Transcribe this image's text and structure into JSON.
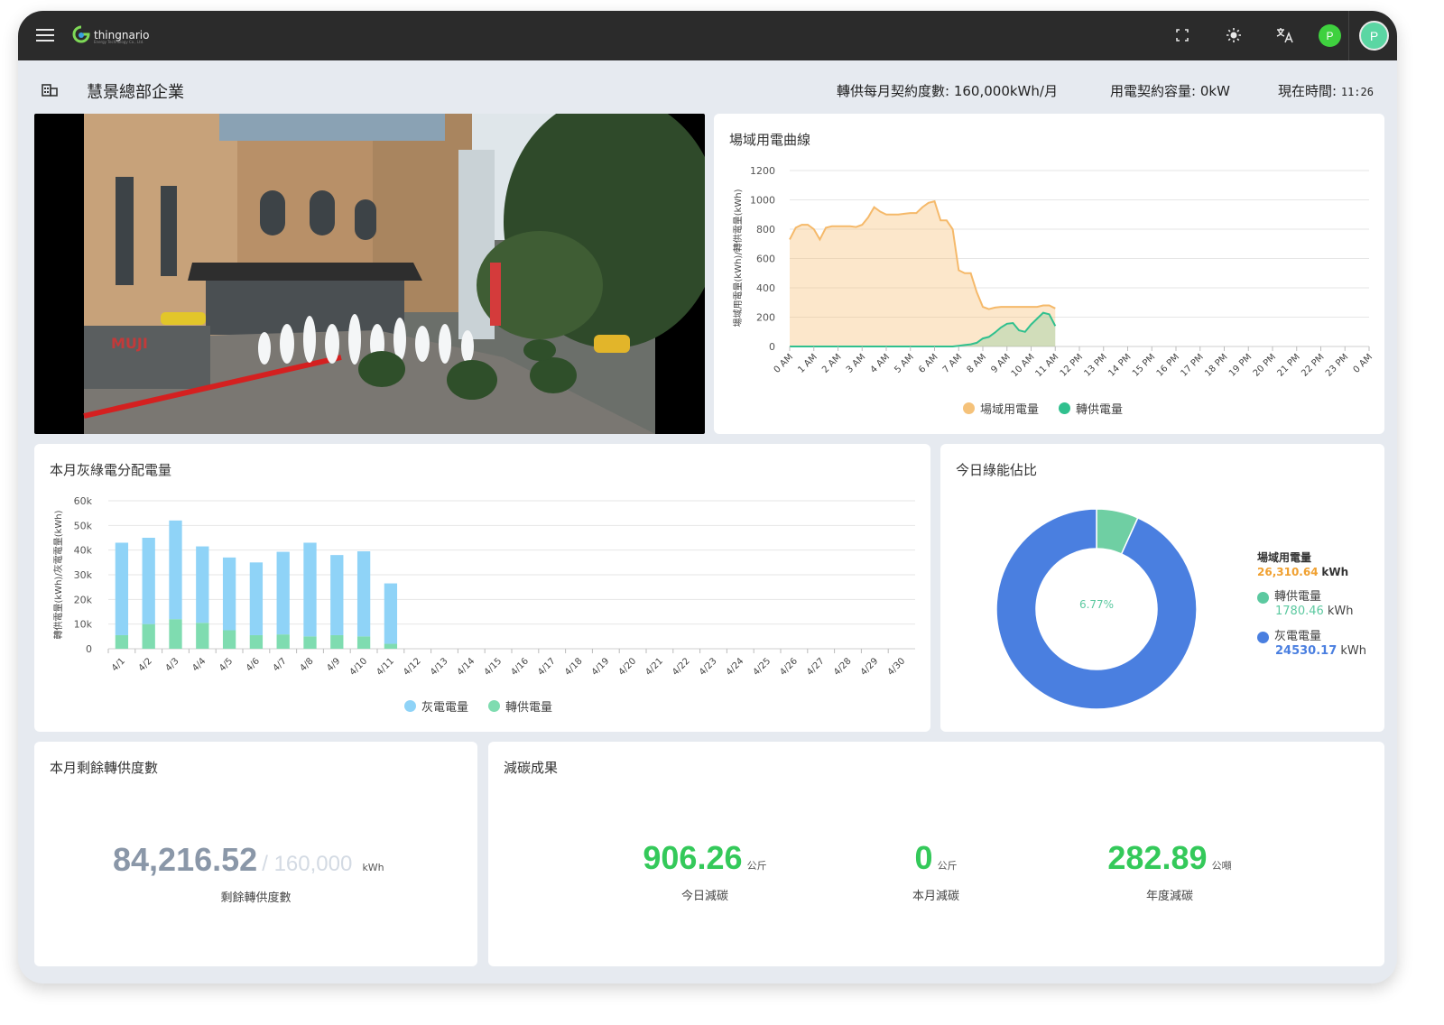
{
  "app": {
    "logo_text": "thingnario",
    "logo_subtext": "Energy Technology Co., Ltd.",
    "menu_icon": "hamburger-icon",
    "toolbar_icons": [
      "fullscreen-icon",
      "brightness-icon",
      "translate-icon"
    ],
    "status_avatar_letter": "P",
    "user_avatar_letter": "P",
    "status_avatar_color": "#3fd13f",
    "user_avatar_color": "#5bd6a3"
  },
  "header": {
    "company_name": "慧景總部企業",
    "contract_label": "轉供每月契約度數:",
    "contract_value": "160,000kWh/月",
    "capacity_label": "用電契約容量:",
    "capacity_value": "0kW",
    "time_label": "現在時間:",
    "time_value": "11:26"
  },
  "site_chart": {
    "title": "場域用電曲線",
    "chart_data": {
      "type": "area",
      "ylabel": "場域用電量(kWh)/轉供電量(kWh)",
      "ylim": [
        0,
        1200
      ],
      "yticks": [
        0,
        200,
        400,
        600,
        800,
        1000,
        1200
      ],
      "x_ticks": [
        "0 AM",
        "1 AM",
        "2 AM",
        "3 AM",
        "4 AM",
        "5 AM",
        "6 AM",
        "7 AM",
        "8 AM",
        "9 AM",
        "10 AM",
        "11 AM",
        "12 PM",
        "13 PM",
        "14 PM",
        "15 PM",
        "16 PM",
        "17 PM",
        "18 PM",
        "19 PM",
        "20 PM",
        "21 PM",
        "22 PM",
        "23 PM",
        "0 AM"
      ],
      "series": [
        {
          "name": "場域用電量",
          "color": "#f5b96a",
          "x": [
            0,
            0.25,
            0.5,
            0.75,
            1,
            1.25,
            1.5,
            1.75,
            2,
            2.25,
            2.5,
            2.75,
            3,
            3.25,
            3.5,
            3.75,
            4,
            4.25,
            4.5,
            4.75,
            5,
            5.25,
            5.5,
            5.75,
            6,
            6.25,
            6.5,
            6.75,
            7,
            7.25,
            7.5,
            7.75,
            8,
            8.25,
            8.5,
            8.75,
            9,
            9.25,
            9.5,
            9.75,
            10,
            10.25,
            10.5,
            10.75,
            11
          ],
          "y": [
            730,
            810,
            830,
            830,
            800,
            730,
            810,
            820,
            820,
            820,
            820,
            815,
            830,
            880,
            950,
            920,
            900,
            900,
            900,
            905,
            910,
            910,
            950,
            980,
            990,
            860,
            860,
            800,
            520,
            500,
            500,
            370,
            270,
            255,
            265,
            270,
            270,
            270,
            270,
            270,
            270,
            270,
            280,
            280,
            260
          ]
        },
        {
          "name": "轉供電量",
          "color": "#30c08e",
          "x": [
            0,
            0.25,
            0.5,
            0.75,
            1,
            1.25,
            1.5,
            1.75,
            2,
            2.25,
            2.5,
            2.75,
            3,
            3.25,
            3.5,
            3.75,
            4,
            4.25,
            4.5,
            4.75,
            5,
            5.25,
            5.5,
            5.75,
            6,
            6.25,
            6.5,
            6.75,
            7,
            7.25,
            7.5,
            7.75,
            8,
            8.25,
            8.5,
            8.75,
            9,
            9.25,
            9.5,
            9.75,
            10,
            10.25,
            10.5,
            10.75,
            11
          ],
          "y": [
            0,
            0,
            0,
            0,
            0,
            0,
            0,
            0,
            0,
            0,
            0,
            0,
            0,
            0,
            0,
            0,
            0,
            0,
            0,
            0,
            0,
            0,
            0,
            0,
            0,
            0,
            0,
            0,
            5,
            10,
            15,
            25,
            55,
            65,
            95,
            130,
            155,
            160,
            110,
            100,
            150,
            190,
            230,
            220,
            140
          ]
        }
      ]
    }
  },
  "monthly_chart": {
    "title": "本月灰綠電分配電量",
    "chart_data": {
      "type": "bar",
      "ylabel": "轉供電量(kWh)/灰電電量(kWh)",
      "ylim": [
        0,
        60000
      ],
      "yticks": [
        0,
        10000,
        20000,
        30000,
        40000,
        50000,
        60000
      ],
      "ytick_labels": [
        "0",
        "10k",
        "20k",
        "30k",
        "40k",
        "50k",
        "60k"
      ],
      "categories": [
        "4/1",
        "4/2",
        "4/3",
        "4/4",
        "4/5",
        "4/6",
        "4/7",
        "4/8",
        "4/9",
        "4/10",
        "4/11",
        "4/12",
        "4/13",
        "4/14",
        "4/15",
        "4/16",
        "4/17",
        "4/18",
        "4/19",
        "4/20",
        "4/21",
        "4/22",
        "4/23",
        "4/24",
        "4/25",
        "4/26",
        "4/27",
        "4/28",
        "4/29",
        "4/30"
      ],
      "series": [
        {
          "name": "灰電電量",
          "color": "#8fd3f7",
          "values": [
            37500,
            35000,
            40000,
            31000,
            29500,
            29500,
            33500,
            38000,
            32500,
            34500,
            24500,
            0,
            0,
            0,
            0,
            0,
            0,
            0,
            0,
            0,
            0,
            0,
            0,
            0,
            0,
            0,
            0,
            0,
            0,
            0
          ]
        },
        {
          "name": "轉供電量",
          "color": "#7fdcb0",
          "values": [
            5500,
            10000,
            12000,
            10500,
            7500,
            5500,
            5800,
            5000,
            5500,
            5000,
            2000,
            0,
            0,
            0,
            0,
            0,
            0,
            0,
            0,
            0,
            0,
            0,
            0,
            0,
            0,
            0,
            0,
            0,
            0,
            0
          ]
        }
      ]
    }
  },
  "donut": {
    "title": "今日綠能佔比",
    "center_label": "6.77%",
    "site_label": "場域用電量",
    "site_value": "26,310.64",
    "site_unit": "kWh",
    "site_color": "#f0a030",
    "green_label": "轉供電量",
    "green_value": "1780.46",
    "green_unit": "kWh",
    "green_color": "#5cc9a0",
    "grey_label": "灰電電量",
    "grey_value": "24530.17",
    "grey_unit": "kWh",
    "grey_color": "#4a7fe0",
    "chart_data": {
      "type": "pie",
      "slices": [
        {
          "name": "轉供電量",
          "value": 1780.46,
          "color": "#6fcfa3"
        },
        {
          "name": "灰電電量",
          "value": 24530.17,
          "color": "#4a7fe0"
        }
      ]
    }
  },
  "remaining": {
    "title": "本月剩餘轉供度數",
    "value": "84,216.52",
    "separator": "/ 160,000",
    "unit": "kWh",
    "caption": "剩餘轉供度數"
  },
  "carbon": {
    "title": "減碳成果",
    "items": [
      {
        "value": "906.26",
        "unit": "公斤",
        "caption": "今日減碳"
      },
      {
        "value": "0",
        "unit": "公斤",
        "caption": "本月減碳"
      },
      {
        "value": "282.89",
        "unit": "公噸",
        "caption": "年度減碳"
      }
    ],
    "color": "#34c95a"
  }
}
